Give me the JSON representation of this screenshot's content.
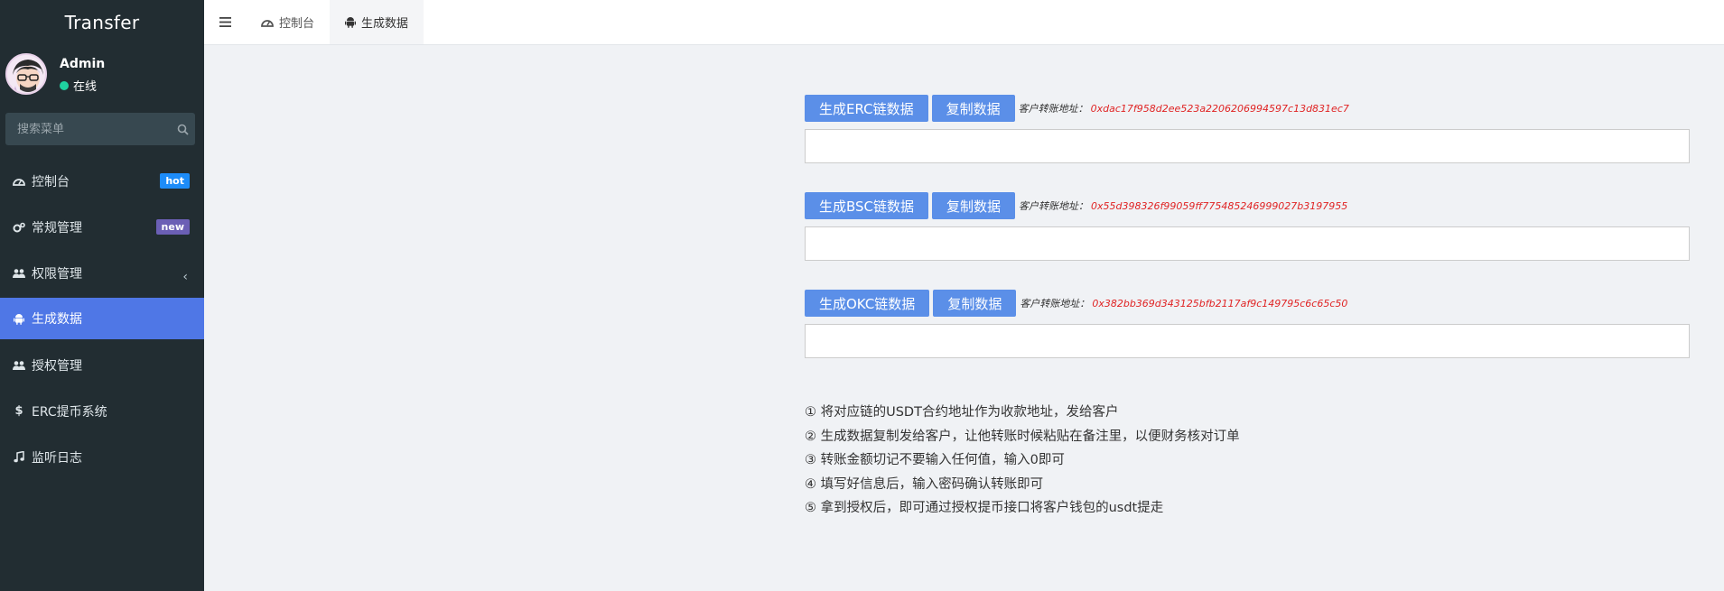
{
  "sidebar": {
    "brand": "Transfer",
    "user": {
      "name": "Admin",
      "status": "在线",
      "status_color": "#1fd1a0"
    },
    "search": {
      "placeholder": "搜索菜单"
    },
    "items": [
      {
        "label": "控制台",
        "icon": "dashboard-icon",
        "badge": "hot"
      },
      {
        "label": "常规管理",
        "icon": "cogs-icon",
        "badge": "new"
      },
      {
        "label": "权限管理",
        "icon": "users-icon",
        "badge": ""
      },
      {
        "label": "生成数据",
        "icon": "android-icon",
        "badge": "",
        "active": true
      },
      {
        "label": "授权管理",
        "icon": "users-icon",
        "badge": ""
      },
      {
        "label": "ERC提币系统",
        "icon": "dollar-icon",
        "badge": ""
      },
      {
        "label": "监听日志",
        "icon": "music-icon",
        "badge": ""
      }
    ]
  },
  "topbar": {
    "tabs": [
      {
        "label": "控制台",
        "icon": "dashboard-icon"
      },
      {
        "label": "生成数据",
        "icon": "android-icon",
        "active": true
      }
    ]
  },
  "chains": [
    {
      "generate_label": "生成ERC链数据",
      "copy_label": "复制数据",
      "addr_label": "客户转账地址：",
      "address": "0xdac17f958d2ee523a2206206994597c13d831ec7"
    },
    {
      "generate_label": "生成BSC链数据",
      "copy_label": "复制数据",
      "addr_label": "客户转账地址：",
      "address": "0x55d398326f99059ff775485246999027b3197955"
    },
    {
      "generate_label": "生成OKC链数据",
      "copy_label": "复制数据",
      "addr_label": "客户转账地址：",
      "address": "0x382bb369d343125bfb2117af9c149795c6c65c50"
    }
  ],
  "notes": [
    "① 将对应链的USDT合约地址作为收款地址，发给客户",
    "② 生成数据复制发给客户，让他转账时候粘贴在备注里，以便财务核对订单",
    "③ 转账金额切记不要输入任何值，输入0即可",
    "④ 填写好信息后，输入密码确认转账即可",
    "⑤ 拿到授权后，即可通过授权提币接口将客户钱包的usdt提走"
  ],
  "colors": {
    "sidebar_bg": "#222d32",
    "active_item": "#4f77e6",
    "button": "#5b8fe8",
    "address": "#e02424"
  }
}
